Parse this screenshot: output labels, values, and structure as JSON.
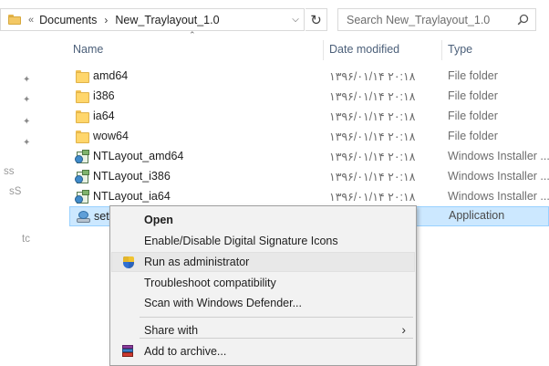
{
  "address_bar": {
    "overflow": "«",
    "crumbs": [
      "Documents",
      "New_Traylayout_1.0"
    ],
    "search_placeholder": "Search New_Traylayout_1.0"
  },
  "columns": {
    "name": "Name",
    "date": "Date modified",
    "type": "Type"
  },
  "nav_fragments": [
    "ss",
    "sS",
    "tc"
  ],
  "files": [
    {
      "name": "amd64",
      "date": "۱۳۹۶/۰۱/۱۴ ۲۰:۱۸",
      "type": "File folder",
      "icon": "folder-icon"
    },
    {
      "name": "i386",
      "date": "۱۳۹۶/۰۱/۱۴ ۲۰:۱۸",
      "type": "File folder",
      "icon": "folder-icon"
    },
    {
      "name": "ia64",
      "date": "۱۳۹۶/۰۱/۱۴ ۲۰:۱۸",
      "type": "File folder",
      "icon": "folder-icon"
    },
    {
      "name": "wow64",
      "date": "۱۳۹۶/۰۱/۱۴ ۲۰:۱۸",
      "type": "File folder",
      "icon": "folder-icon"
    },
    {
      "name": "NTLayout_amd64",
      "date": "۱۳۹۶/۰۱/۱۴ ۲۰:۱۸",
      "type": "Windows Installer ...",
      "icon": "installer-icon"
    },
    {
      "name": "NTLayout_i386",
      "date": "۱۳۹۶/۰۱/۱۴ ۲۰:۱۸",
      "type": "Windows Installer ...",
      "icon": "installer-icon"
    },
    {
      "name": "NTLayout_ia64",
      "date": "۱۳۹۶/۰۱/۱۴ ۲۰:۱۸",
      "type": "Windows Installer ...",
      "icon": "installer-icon"
    },
    {
      "name": "set",
      "date": "",
      "type": "Application",
      "icon": "setup-icon",
      "selected": true
    }
  ],
  "context_menu": {
    "items": [
      {
        "label": "Open",
        "bold": true
      },
      {
        "label": "Enable/Disable Digital Signature Icons"
      },
      {
        "label": "Run as administrator",
        "icon": "shield-icon",
        "hover": true
      },
      {
        "label": "Troubleshoot compatibility"
      },
      {
        "label": "Scan with Windows Defender..."
      },
      {
        "label": "Share with",
        "submenu": true
      },
      {
        "label": "Add to archive...",
        "icon": "winrar-icon"
      }
    ]
  },
  "colors": {
    "selection_bg": "#cce8ff",
    "selection_border": "#99d1ff",
    "header_text": "#4c607a",
    "menu_bg": "#f2f2f2"
  }
}
